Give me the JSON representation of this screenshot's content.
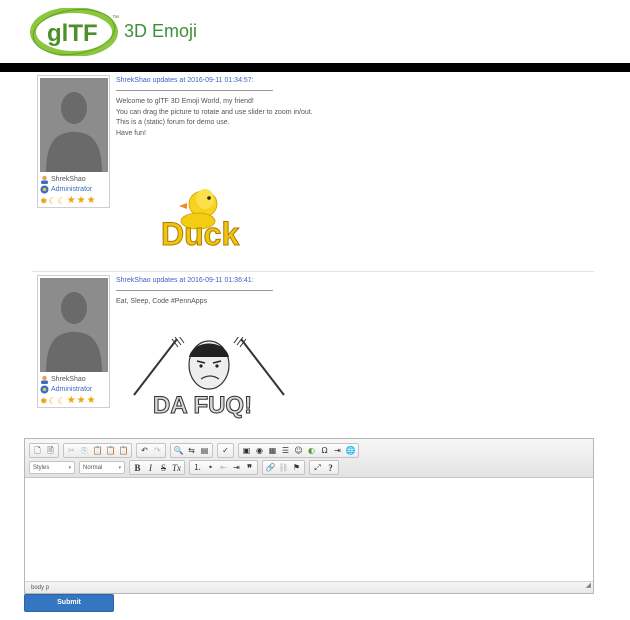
{
  "header": {
    "logo_text": "glTF",
    "logo_tm": "™",
    "site_title": "3D Emoji"
  },
  "posts": [
    {
      "header": "ShrekShao updates at 2016-09-11 01:34:57:",
      "body": [
        "Welcome to glTF 3D Emoji World, my friend!",
        "You can drag the picture to rotate and use slider to zoom in/out.",
        "This is a (static) forum for demo use.",
        "Have fun!"
      ],
      "user": {
        "name": "ShrekShao",
        "role": "Administrator"
      },
      "emoji": "Duck"
    },
    {
      "header": "ShrekShao updates at 2016-09-11 01:36:41:",
      "body": [
        "Eat, Sleep, Code   #PennApps"
      ],
      "user": {
        "name": "ShrekShao",
        "role": "Administrator"
      },
      "emoji": "DA FUQ!"
    }
  ],
  "editor": {
    "styles_label": "Styles",
    "format_label": "Normal",
    "statusbar": "body  p"
  },
  "submit_label": "Submit",
  "colors": {
    "brand_green": "#3f8f3a",
    "link_blue": "#3f5fc9",
    "button_blue": "#3476c0"
  }
}
